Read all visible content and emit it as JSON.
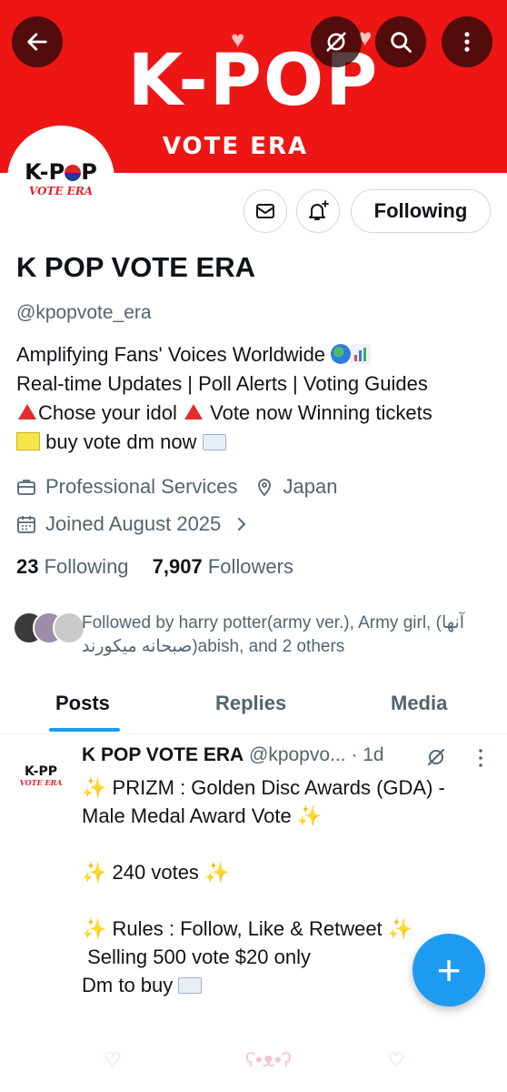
{
  "banner": {
    "logo_text": "K-POP",
    "sub_text": "VOTE ERA",
    "colors": {
      "background": "#ee1515",
      "text": "#ffffff"
    }
  },
  "toolbar": {
    "back_icon": "arrow-left-icon",
    "grok_icon": "grok-slash-icon",
    "search_icon": "search-icon",
    "more_icon": "more-vertical-icon"
  },
  "avatar": {
    "line1": "K-P",
    "line1_tail": "P",
    "line2": "VOTE ERA"
  },
  "actions": {
    "message_icon": "mail-icon",
    "notify_icon": "bell-plus-icon",
    "following_label": "Following"
  },
  "profile": {
    "name": "K POP VOTE ERA",
    "handle": "@kpopvote_era",
    "bio": {
      "line1": "Amplifying Fans' Voices Worldwide",
      "line2": "Real-time Updates | Poll Alerts | Voting Guides",
      "line3a": "Chose your idol",
      "line3b": "Vote now Winning tickets",
      "line4": "buy vote dm now"
    },
    "category": "Professional Services",
    "location": "Japan",
    "joined": "Joined August 2025",
    "following_count": "23",
    "following_label": "Following",
    "followers_count": "7,907",
    "followers_label": "Followers",
    "followed_by": "Followed by harry potter(army ver.), Army girl, (آنها صبحانه میکورند)abish, and 2 others"
  },
  "tabs": [
    {
      "label": "Posts",
      "active": true
    },
    {
      "label": "Replies",
      "active": false
    },
    {
      "label": "Media",
      "active": false
    }
  ],
  "post": {
    "author": "K POP VOTE ERA",
    "handle": "@kpopvo...",
    "time": "· 1d",
    "line1": "PRIZM :  Golden Disc Awards (GDA) -",
    "line2": "Male Medal Award Vote",
    "line3": "240 votes",
    "line4": "Rules : Follow, Like & Retweet",
    "line5": "Selling 500 vote $20 only",
    "line6": "Dm to buy"
  },
  "fab": {
    "label": "+"
  },
  "accent_color": "#1d9bf0"
}
